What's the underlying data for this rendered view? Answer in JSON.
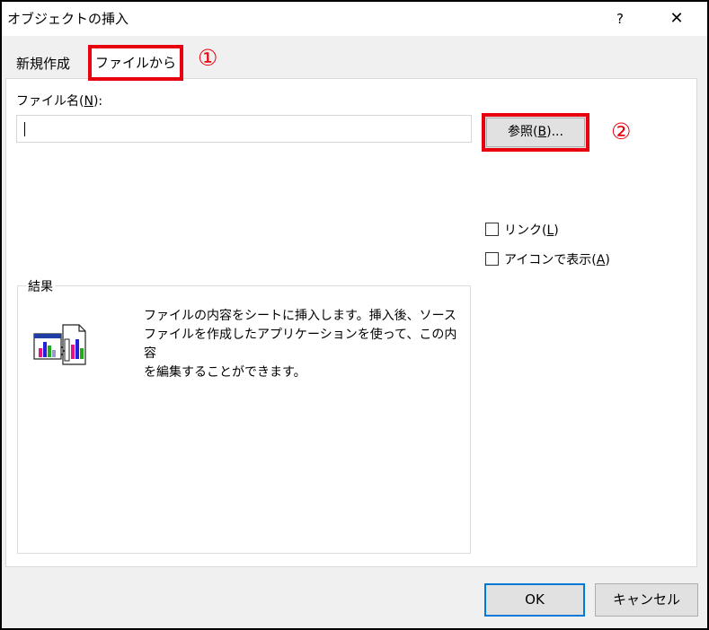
{
  "window": {
    "title": "オブジェクトの挿入",
    "help_label": "?",
    "close_label": "✕"
  },
  "tabs": [
    {
      "label": "新規作成"
    },
    {
      "label": "ファイルから"
    }
  ],
  "annotations": {
    "marker1": "①",
    "marker2": "②",
    "highlight_color": "#e8000f"
  },
  "file_name": {
    "label_prefix": "ファイル名(",
    "label_key": "N",
    "label_suffix": "):",
    "value": ""
  },
  "browse_button": {
    "label_prefix": "参照(",
    "label_key": "B",
    "label_suffix": ")..."
  },
  "options": {
    "link": {
      "prefix": "リンク(",
      "key": "L",
      "suffix": ")",
      "checked": false
    },
    "display_as_icon": {
      "prefix": "アイコンで表示(",
      "key": "A",
      "suffix": ")",
      "checked": false
    }
  },
  "result": {
    "title": "結果",
    "icon": "insert-file-object-icon",
    "lines": [
      "ファイルの内容をシートに挿入します。挿入後、ソース",
      "ファイルを作成したアプリケーションを使って、この内容",
      "を編集することができます。"
    ]
  },
  "buttons": {
    "ok": "OK",
    "cancel": "キャンセル"
  }
}
